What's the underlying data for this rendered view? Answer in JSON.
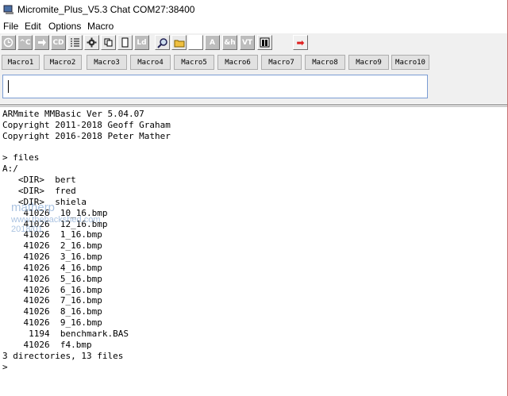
{
  "window": {
    "title": "Micromite_Plus_V5.3 Chat  COM27:38400"
  },
  "menu": [
    "File",
    "Edit",
    "Options",
    "Macro"
  ],
  "toolbar": {
    "labels": {
      "ctrl_c": "^C",
      "cd": "CD",
      "ld": "Ld",
      "a": "A",
      "ah": "&h",
      "vt": "VT",
      "arrow": "➡"
    }
  },
  "macros": [
    "Macro1",
    "Macro2",
    "Macro3",
    "Macro4",
    "Macro5",
    "Macro6",
    "Macro7",
    "Macro8",
    "Macro9",
    "Macro10"
  ],
  "input": {
    "value": ""
  },
  "terminal": {
    "lines": [
      "ARMmite MMBasic Ver 5.04.07",
      "Copyright 2011-2018 Geoff Graham",
      "Copyright 2016-2018 Peter Mather",
      "",
      "> files",
      "A:/",
      "   <DIR>  bert",
      "   <DIR>  fred",
      "   <DIR>  shiela",
      "    41026  10_16.bmp",
      "    41026  12_16.bmp",
      "    41026  1_16.bmp",
      "    41026  2_16.bmp",
      "    41026  3_16.bmp",
      "    41026  4_16.bmp",
      "    41026  5_16.bmp",
      "    41026  6_16.bmp",
      "    41026  7_16.bmp",
      "    41026  8_16.bmp",
      "    41026  9_16.bmp",
      "     1194  benchmark.BAS",
      "    41026  f4.bmp",
      "3 directories, 13 files",
      ">"
    ]
  },
  "watermark": {
    "line1": "matherp",
    "line2": "www.thebackshed.com",
    "line3": "2018/01"
  }
}
